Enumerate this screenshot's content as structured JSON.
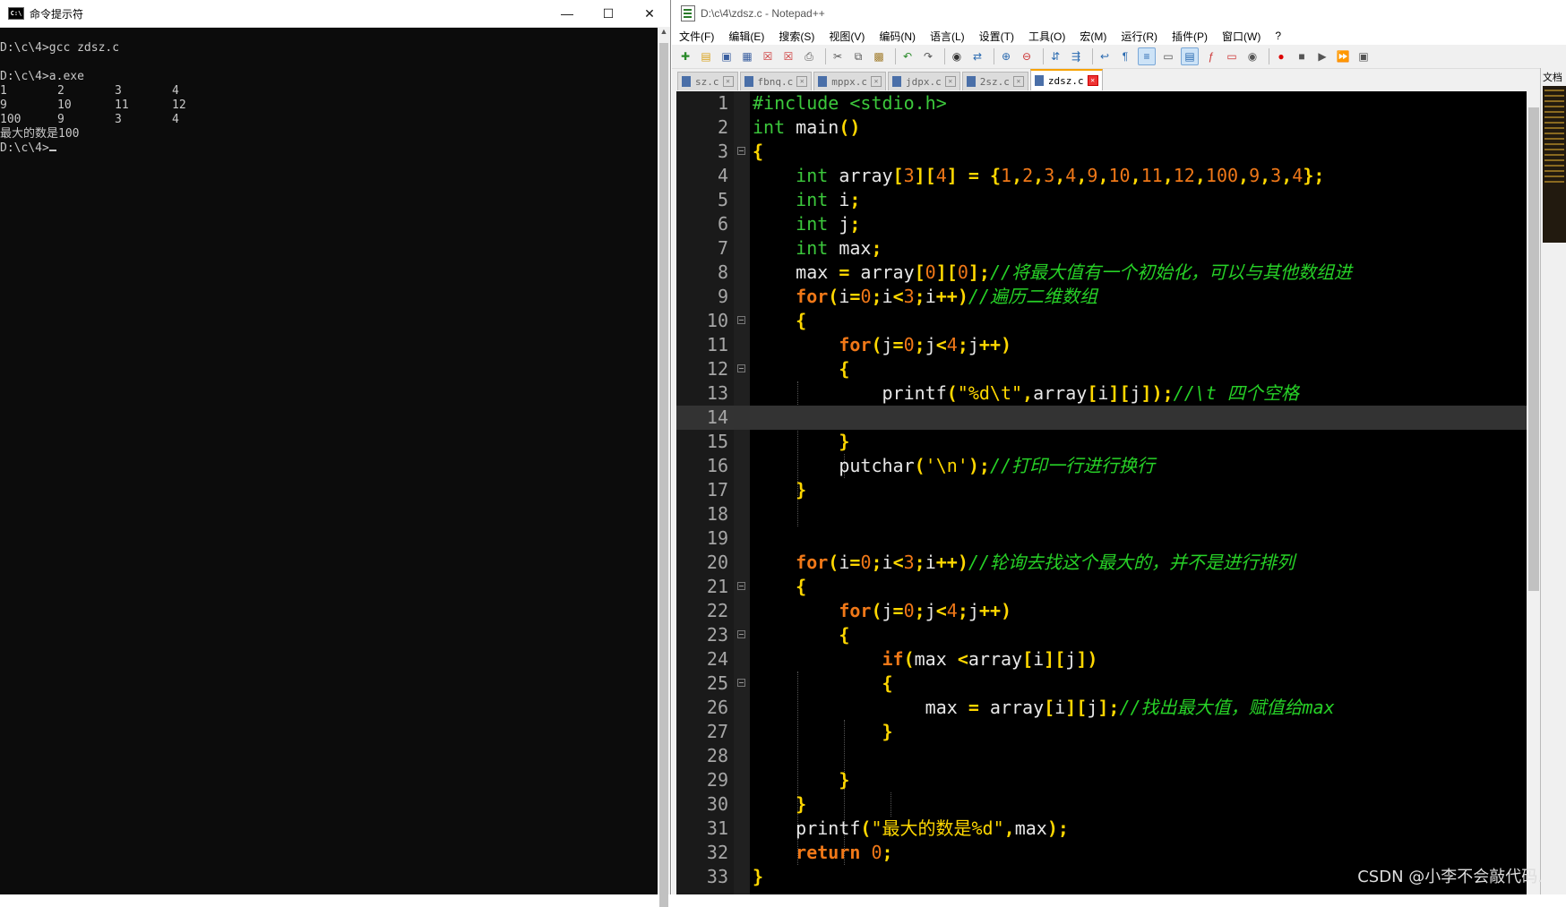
{
  "cmd": {
    "title": "命令提示符",
    "lines": [
      "D:\\c\\4>gcc zdsz.c",
      "",
      "D:\\c\\4>a.exe"
    ],
    "rows": [
      [
        "1",
        "2",
        "3",
        "4"
      ],
      [
        "9",
        "10",
        "11",
        "12"
      ],
      [
        "100",
        "9",
        "3",
        "4"
      ]
    ],
    "result": "最大的数是100",
    "prompt": "D:\\c\\4>"
  },
  "npp": {
    "title": "D:\\c\\4\\zdsz.c - Notepad++",
    "menu": [
      "文件(F)",
      "编辑(E)",
      "搜索(S)",
      "视图(V)",
      "编码(N)",
      "语言(L)",
      "设置(T)",
      "工具(O)",
      "宏(M)",
      "运行(R)",
      "插件(P)",
      "窗口(W)",
      "?"
    ],
    "tabs": [
      {
        "label": "sz.c",
        "active": false
      },
      {
        "label": "fbnq.c",
        "active": false
      },
      {
        "label": "mppx.c",
        "active": false
      },
      {
        "label": "jdpx.c",
        "active": false
      },
      {
        "label": "2sz.c",
        "active": false
      },
      {
        "label": "zdsz.c",
        "active": true
      }
    ],
    "docmap_label": "文档",
    "current_line": 14
  },
  "code_lines": [
    [
      [
        "pp",
        "#include <stdio.h>"
      ]
    ],
    [
      [
        "t",
        "int"
      ],
      [
        "id",
        " main"
      ],
      [
        "p",
        "()"
      ]
    ],
    [
      [
        "p",
        "{"
      ]
    ],
    [
      [
        "id",
        "    "
      ],
      [
        "t",
        "int"
      ],
      [
        "id",
        " array"
      ],
      [
        "p",
        "["
      ],
      [
        "n",
        "3"
      ],
      [
        "p",
        "]["
      ],
      [
        "n",
        "4"
      ],
      [
        "p",
        "]"
      ],
      [
        "id",
        " "
      ],
      [
        "p",
        "="
      ],
      [
        "id",
        " "
      ],
      [
        "p",
        "{"
      ],
      [
        "n",
        "1"
      ],
      [
        "p",
        ","
      ],
      [
        "n",
        "2"
      ],
      [
        "p",
        ","
      ],
      [
        "n",
        "3"
      ],
      [
        "p",
        ","
      ],
      [
        "n",
        "4"
      ],
      [
        "p",
        ","
      ],
      [
        "n",
        "9"
      ],
      [
        "p",
        ","
      ],
      [
        "n",
        "10"
      ],
      [
        "p",
        ","
      ],
      [
        "n",
        "11"
      ],
      [
        "p",
        ","
      ],
      [
        "n",
        "12"
      ],
      [
        "p",
        ","
      ],
      [
        "n",
        "100"
      ],
      [
        "p",
        ","
      ],
      [
        "n",
        "9"
      ],
      [
        "p",
        ","
      ],
      [
        "n",
        "3"
      ],
      [
        "p",
        ","
      ],
      [
        "n",
        "4"
      ],
      [
        "p",
        "};"
      ]
    ],
    [
      [
        "id",
        "    "
      ],
      [
        "t",
        "int"
      ],
      [
        "id",
        " i"
      ],
      [
        "p",
        ";"
      ]
    ],
    [
      [
        "id",
        "    "
      ],
      [
        "t",
        "int"
      ],
      [
        "id",
        " j"
      ],
      [
        "p",
        ";"
      ]
    ],
    [
      [
        "id",
        "    "
      ],
      [
        "t",
        "int"
      ],
      [
        "id",
        " max"
      ],
      [
        "p",
        ";"
      ]
    ],
    [
      [
        "id",
        "    max "
      ],
      [
        "p",
        "="
      ],
      [
        "id",
        " array"
      ],
      [
        "p",
        "["
      ],
      [
        "n",
        "0"
      ],
      [
        "p",
        "]["
      ],
      [
        "n",
        "0"
      ],
      [
        "p",
        "];"
      ],
      [
        "c",
        "//将最大值有一个初始化，可以与其他数组进"
      ]
    ],
    [
      [
        "id",
        "    "
      ],
      [
        "k",
        "for"
      ],
      [
        "p",
        "("
      ],
      [
        "id",
        "i"
      ],
      [
        "p",
        "="
      ],
      [
        "n",
        "0"
      ],
      [
        "p",
        ";"
      ],
      [
        "id",
        "i"
      ],
      [
        "p",
        "<"
      ],
      [
        "n",
        "3"
      ],
      [
        "p",
        ";"
      ],
      [
        "id",
        "i"
      ],
      [
        "p",
        "++)"
      ],
      [
        "c",
        "//遍历二维数组"
      ]
    ],
    [
      [
        "id",
        "    "
      ],
      [
        "p",
        "{"
      ]
    ],
    [
      [
        "id",
        "        "
      ],
      [
        "k",
        "for"
      ],
      [
        "p",
        "("
      ],
      [
        "id",
        "j"
      ],
      [
        "p",
        "="
      ],
      [
        "n",
        "0"
      ],
      [
        "p",
        ";"
      ],
      [
        "id",
        "j"
      ],
      [
        "p",
        "<"
      ],
      [
        "n",
        "4"
      ],
      [
        "p",
        ";"
      ],
      [
        "id",
        "j"
      ],
      [
        "p",
        "++)"
      ]
    ],
    [
      [
        "id",
        "        "
      ],
      [
        "p",
        "{"
      ]
    ],
    [
      [
        "id",
        "            printf"
      ],
      [
        "p",
        "("
      ],
      [
        "s",
        "\"%d\\t\""
      ],
      [
        "p",
        ","
      ],
      [
        "id",
        "array"
      ],
      [
        "p",
        "["
      ],
      [
        "id",
        "i"
      ],
      [
        "p",
        "]["
      ],
      [
        "id",
        "j"
      ],
      [
        "p",
        "]);"
      ],
      [
        "c",
        "//\\t 四个空格"
      ]
    ],
    [],
    [
      [
        "id",
        "        "
      ],
      [
        "p",
        "}"
      ]
    ],
    [
      [
        "id",
        "        putchar"
      ],
      [
        "p",
        "("
      ],
      [
        "s",
        "'\\n'"
      ],
      [
        "p",
        ");"
      ],
      [
        "c",
        "//打印一行进行换行"
      ]
    ],
    [
      [
        "id",
        "    "
      ],
      [
        "p",
        "}"
      ]
    ],
    [],
    [],
    [
      [
        "id",
        "    "
      ],
      [
        "k",
        "for"
      ],
      [
        "p",
        "("
      ],
      [
        "id",
        "i"
      ],
      [
        "p",
        "="
      ],
      [
        "n",
        "0"
      ],
      [
        "p",
        ";"
      ],
      [
        "id",
        "i"
      ],
      [
        "p",
        "<"
      ],
      [
        "n",
        "3"
      ],
      [
        "p",
        ";"
      ],
      [
        "id",
        "i"
      ],
      [
        "p",
        "++)"
      ],
      [
        "c",
        "//轮询去找这个最大的，并不是进行排列"
      ]
    ],
    [
      [
        "id",
        "    "
      ],
      [
        "p",
        "{"
      ]
    ],
    [
      [
        "id",
        "        "
      ],
      [
        "k",
        "for"
      ],
      [
        "p",
        "("
      ],
      [
        "id",
        "j"
      ],
      [
        "p",
        "="
      ],
      [
        "n",
        "0"
      ],
      [
        "p",
        ";"
      ],
      [
        "id",
        "j"
      ],
      [
        "p",
        "<"
      ],
      [
        "n",
        "4"
      ],
      [
        "p",
        ";"
      ],
      [
        "id",
        "j"
      ],
      [
        "p",
        "++)"
      ]
    ],
    [
      [
        "id",
        "        "
      ],
      [
        "p",
        "{"
      ]
    ],
    [
      [
        "id",
        "            "
      ],
      [
        "k",
        "if"
      ],
      [
        "p",
        "("
      ],
      [
        "id",
        "max "
      ],
      [
        "p",
        "<"
      ],
      [
        "id",
        "array"
      ],
      [
        "p",
        "["
      ],
      [
        "id",
        "i"
      ],
      [
        "p",
        "]["
      ],
      [
        "id",
        "j"
      ],
      [
        "p",
        "])"
      ]
    ],
    [
      [
        "id",
        "            "
      ],
      [
        "p",
        "{"
      ]
    ],
    [
      [
        "id",
        "                max "
      ],
      [
        "p",
        "="
      ],
      [
        "id",
        " array"
      ],
      [
        "p",
        "["
      ],
      [
        "id",
        "i"
      ],
      [
        "p",
        "]["
      ],
      [
        "id",
        "j"
      ],
      [
        "p",
        "];"
      ],
      [
        "c",
        "//找出最大值，赋值给max"
      ]
    ],
    [
      [
        "id",
        "            "
      ],
      [
        "p",
        "}"
      ]
    ],
    [],
    [
      [
        "id",
        "        "
      ],
      [
        "p",
        "}"
      ]
    ],
    [
      [
        "id",
        "    "
      ],
      [
        "p",
        "}"
      ]
    ],
    [
      [
        "id",
        "    printf"
      ],
      [
        "p",
        "("
      ],
      [
        "s",
        "\"最大的数是%d\""
      ],
      [
        "p",
        ","
      ],
      [
        "id",
        "max"
      ],
      [
        "p",
        ");"
      ]
    ],
    [
      [
        "id",
        "    "
      ],
      [
        "k",
        "return"
      ],
      [
        "id",
        " "
      ],
      [
        "n",
        "0"
      ],
      [
        "p",
        ";"
      ]
    ],
    [
      [
        "p",
        "}"
      ]
    ]
  ],
  "fold_lines": [
    3,
    10,
    12,
    21,
    23,
    25
  ],
  "watermark": "CSDN @小李不会敲代码."
}
